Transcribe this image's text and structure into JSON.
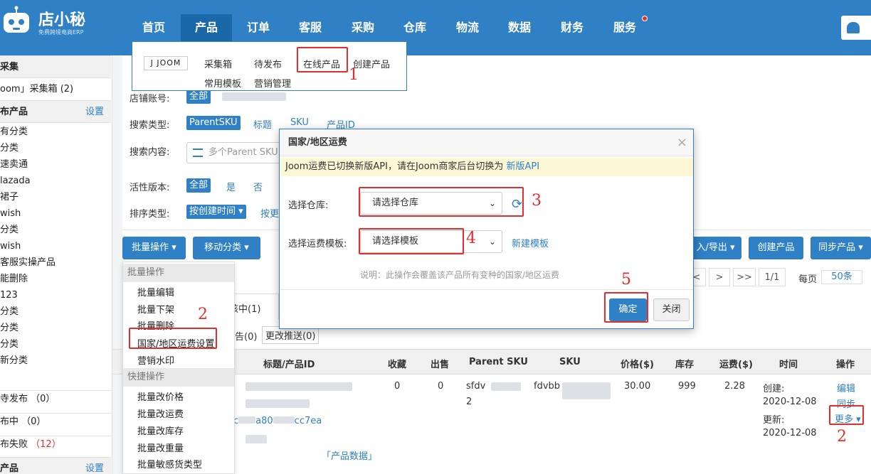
{
  "app": {
    "logo_text": "店小秘",
    "logo_sub": "免费跨境电商ERP"
  },
  "nav": [
    "首页",
    "产品",
    "订单",
    "客服",
    "采购",
    "仓库",
    "物流",
    "数据",
    "财务",
    "服务"
  ],
  "product_menu": {
    "brand": "J JOOM",
    "items": [
      "采集箱",
      "待发布",
      "在线产品",
      "创建产品",
      "常用模板",
      "营销管理"
    ]
  },
  "sidebar": {
    "collect_head": "采集",
    "collect_item": "oom」采集箱 (2)",
    "publish_head": "布产品",
    "publish_link": "设置",
    "publish_items": [
      "有分类",
      "分类",
      "速卖通",
      "lazada",
      "裙子",
      "wish",
      "分类",
      "wish",
      "客服实操产品",
      "能删除",
      "123",
      "分类",
      "分类",
      "分类",
      "新分类"
    ],
    "status_items": [
      {
        "label": "寺发布",
        "count": "（0）"
      },
      {
        "label": "布中",
        "count": "（0）"
      },
      {
        "label": "布失败",
        "count": "（12）"
      }
    ],
    "bottom_head": "产品",
    "bottom_link": "设置"
  },
  "filters": {
    "account_label": "店铺账号:",
    "account_all": "全部",
    "search_type_label": "搜索类型:",
    "search_types": [
      "ParentSKU",
      "标题",
      "SKU",
      "产品ID"
    ],
    "content_label": "搜索内容:",
    "content_placeholder": "多个Parent SKU",
    "active_label": "活性版本:",
    "active_opts": [
      "全部",
      "是",
      "否"
    ],
    "sort_label": "排序类型:",
    "sort_selected": "按创建时间 ▾",
    "sort_other": "按更"
  },
  "toolbar": {
    "batch": "批量操作 ▾",
    "move": "移动分类 ▾",
    "import_export": "入/导出 ▾",
    "create": "创建产品",
    "sync": "同步产品 ▾"
  },
  "pager": {
    "prev": "<",
    "next": ">",
    "last": ">>",
    "page": "1/1",
    "per_page_label": "每页",
    "per_page": "50条"
  },
  "tabs": [
    "核中(1)",
    "告(0)",
    "更改推送(0)"
  ],
  "batch_menu": {
    "group1": "批量操作",
    "items1": [
      "批量编辑",
      "批量下架",
      "批量删除",
      "国家/地区运费设置",
      "营销水印"
    ],
    "group2": "快捷操作",
    "items2": [
      "批量改价格",
      "批量改运费",
      "批量改库存",
      "批量改重量",
      "批量敏感货类型"
    ]
  },
  "table": {
    "headers": [
      "标题/产品ID",
      "收藏",
      "出售",
      "Parent SKU",
      "SKU",
      "价格($)",
      "库存",
      "运费($)",
      "时间",
      "操作"
    ],
    "row": {
      "id_fragment_a": "c",
      "id_fragment_b": "a80",
      "id_fragment_c": "cc7ea",
      "product_data": "「产品数据」",
      "favorites": "0",
      "sold": "0",
      "parent_sku_a": "sfdv",
      "parent_sku_b": "2",
      "sku": "fdvbb",
      "price": "30.00",
      "stock": "999",
      "shipping": "2.28",
      "created_label": "创建:",
      "created": "2020-12-08",
      "updated_label": "更新:",
      "updated": "2020-12-08",
      "actions": [
        "编辑",
        "同步",
        "更多 ▾"
      ]
    }
  },
  "modal": {
    "title": "国家/地区运费",
    "notice": "Joom运费已切换新版API，请在Joom商家后台切换为",
    "notice_link": "新版API",
    "warehouse_label": "选择仓库:",
    "warehouse_placeholder": "请选择仓库",
    "template_label": "选择运费模板:",
    "template_placeholder": "请选择模板",
    "new_template": "新建模板",
    "note": "说明：此操作会覆盖该产品所有变种的国家/地区运费",
    "confirm": "确定",
    "close": "关闭"
  },
  "annotations": [
    "1",
    "2",
    "3",
    "4",
    "5",
    "2"
  ],
  "colors": {
    "brand": "#2f80c4",
    "annotation": "#e52d2d",
    "notice_bg": "#fcf8d6"
  }
}
